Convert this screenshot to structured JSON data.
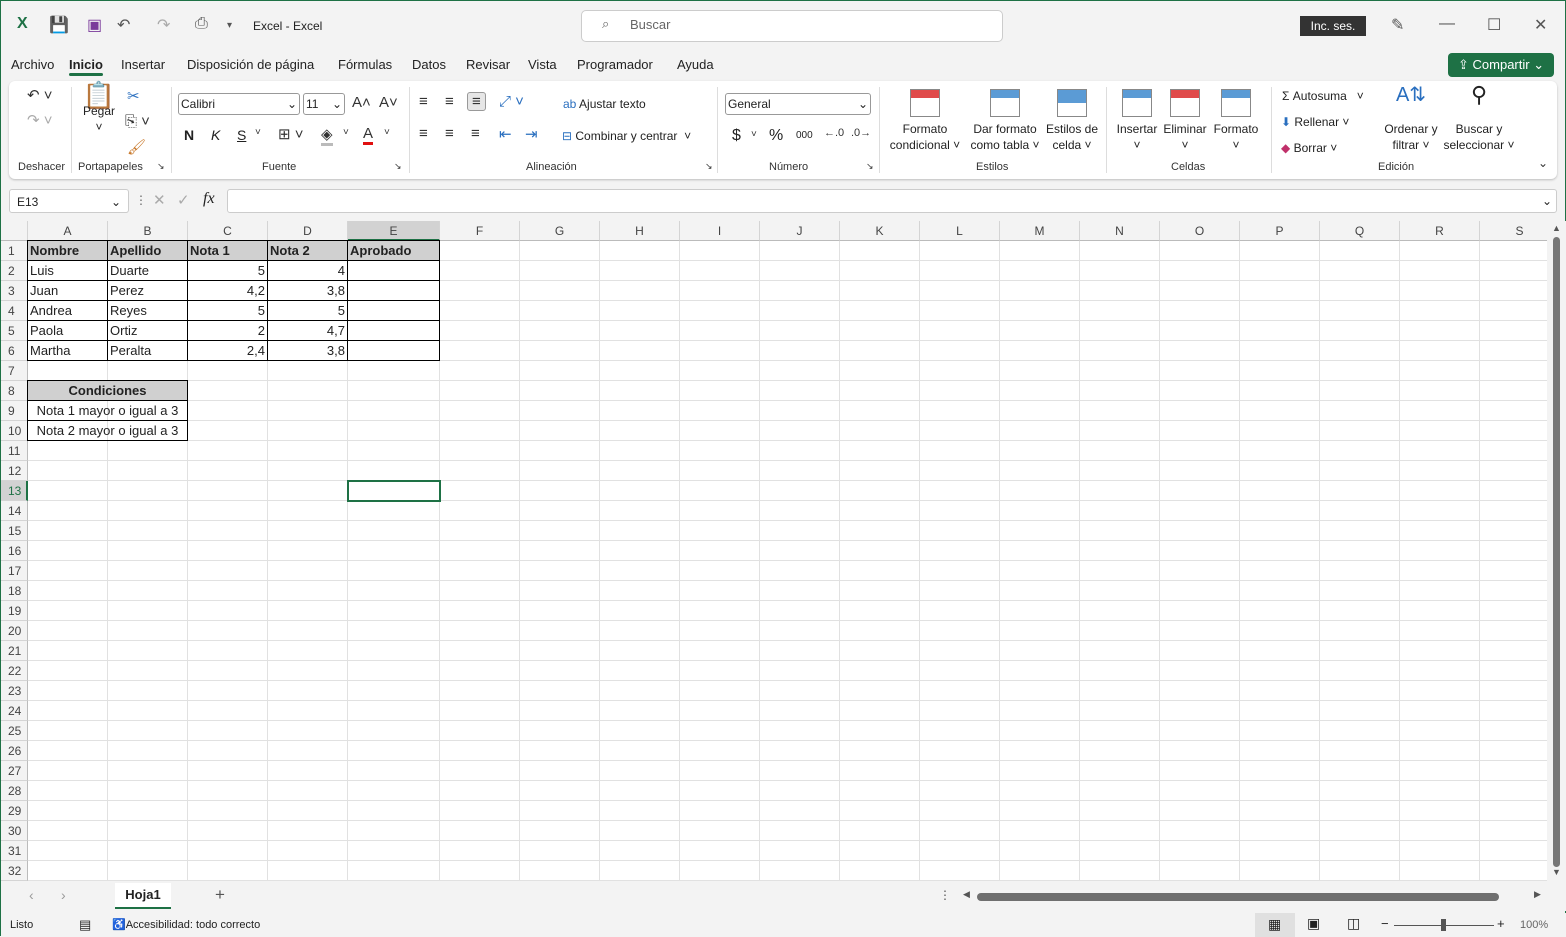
{
  "title": "Excel  -  Excel",
  "search_placeholder": "Buscar",
  "signin": "Inc. ses.",
  "menus": [
    "Archivo",
    "Inicio",
    "Insertar",
    "Disposición de página",
    "Fórmulas",
    "Datos",
    "Revisar",
    "Vista",
    "Programador",
    "Ayuda"
  ],
  "active_menu": "Inicio",
  "share": "Compartir",
  "ribbon": {
    "groups": [
      "Deshacer",
      "Portapapeles",
      "Fuente",
      "Alineación",
      "Número",
      "Estilos",
      "Celdas",
      "Edición"
    ],
    "paste": "Pegar",
    "font": "Calibri",
    "size": "11",
    "bold": "N",
    "italic": "K",
    "underline": "S",
    "wrap": "Ajustar texto",
    "merge": "Combinar y centrar",
    "number_format": "General",
    "currency": "$",
    "percent": "%",
    "thousands": "000",
    "cond_format": [
      "Formato",
      "condicional"
    ],
    "format_table": [
      "Dar formato",
      "como tabla"
    ],
    "cell_styles": [
      "Estilos de",
      "celda"
    ],
    "insert": "Insertar",
    "delete": "Eliminar",
    "format": "Formato",
    "autosum": "Autosuma",
    "fill": "Rellenar",
    "clear": "Borrar",
    "sort": [
      "Ordenar y",
      "filtrar"
    ],
    "find": [
      "Buscar y",
      "seleccionar"
    ]
  },
  "name_box": "E13",
  "fx": "fx",
  "columns": [
    "A",
    "B",
    "C",
    "D",
    "E",
    "F",
    "G",
    "H",
    "I",
    "J",
    "K",
    "L",
    "M",
    "N",
    "O",
    "P",
    "Q",
    "R",
    "S"
  ],
  "selected_cell": "E13",
  "cells": [
    [
      [
        "Nombre",
        "hd"
      ],
      [
        "Apellido",
        "hd"
      ],
      [
        "Nota 1",
        "hd"
      ],
      [
        "Nota 2",
        "hd"
      ],
      [
        "Aprobado",
        "hd"
      ]
    ],
    [
      [
        "Luis",
        ""
      ],
      [
        "Duarte",
        ""
      ],
      [
        "5",
        "num"
      ],
      [
        "4",
        "num"
      ],
      [
        "",
        ""
      ]
    ],
    [
      [
        "Juan",
        ""
      ],
      [
        "Perez",
        ""
      ],
      [
        "4,2",
        "num"
      ],
      [
        "3,8",
        "num"
      ],
      [
        "",
        ""
      ]
    ],
    [
      [
        "Andrea",
        ""
      ],
      [
        "Reyes",
        ""
      ],
      [
        "5",
        "num"
      ],
      [
        "5",
        "num"
      ],
      [
        "",
        ""
      ]
    ],
    [
      [
        "Paola",
        ""
      ],
      [
        "Ortiz",
        ""
      ],
      [
        "2",
        "num"
      ],
      [
        "4,7",
        "num"
      ],
      [
        "",
        ""
      ]
    ],
    [
      [
        "Martha",
        ""
      ],
      [
        "Peralta",
        ""
      ],
      [
        "2,4",
        "num"
      ],
      [
        "3,8",
        "num"
      ],
      [
        "",
        ""
      ]
    ]
  ],
  "conditions": {
    "header": "Condiciones",
    "items": [
      "Nota 1 mayor o igual a 3",
      "Nota 2 mayor o igual a 3"
    ]
  },
  "sheet_tab": "Hoja1",
  "status": {
    "ready": "Listo",
    "accessibility": "Accesibilidad: todo correcto",
    "zoom": "100%",
    "zoom_percent": 100
  }
}
